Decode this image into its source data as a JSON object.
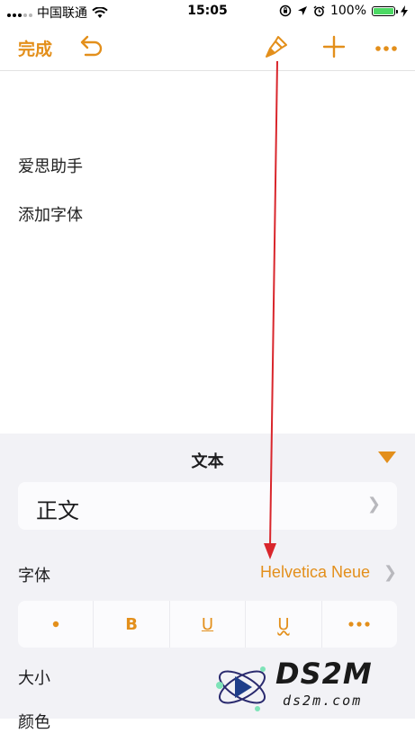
{
  "status": {
    "carrier": "中国联通",
    "time": "15:05",
    "battery_text": "100%",
    "battery_level": 1.0
  },
  "toolbar": {
    "done_label": "完成"
  },
  "document": {
    "lines": [
      "爱思助手",
      "添加字体"
    ]
  },
  "panel": {
    "title": "文本",
    "paragraph_style": "正文",
    "font_label": "字体",
    "font_value": "Helvetica Neue",
    "format_buttons": {
      "bold": "B",
      "italic_underline": "U",
      "strike": "U"
    },
    "size_label": "大小",
    "color_label": "颜色"
  },
  "watermark": {
    "title": "DS2M",
    "subtitle": "ds2m.com"
  },
  "colors": {
    "accent": "#e38f1b",
    "annotation_arrow": "#d9262c",
    "battery": "#4cd964"
  },
  "icons": [
    "wifi-icon",
    "orientation-lock-icon",
    "location-icon",
    "alarm-icon",
    "battery-icon",
    "charging-icon",
    "undo-icon",
    "paintbrush-icon",
    "plus-icon",
    "more-icon",
    "chevron-right-icon",
    "collapse-triangle-icon"
  ]
}
